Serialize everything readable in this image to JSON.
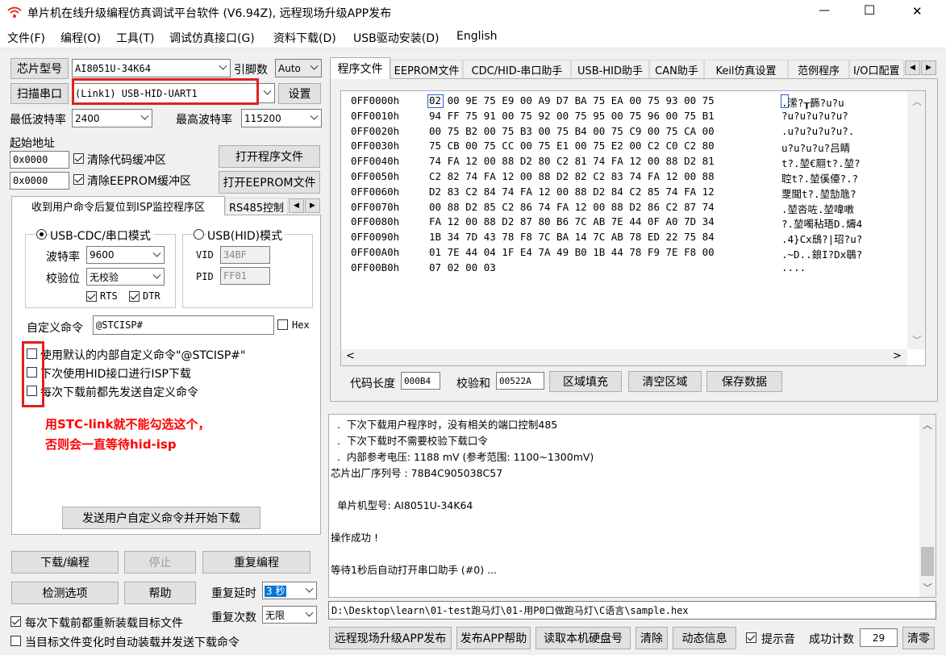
{
  "window": {
    "title": "单片机在线升级编程仿真调试平台软件 (V6.94Z), 远程现场升级APP发布",
    "controls": {
      "minimize": "—",
      "maximize": "☐",
      "close": "✕"
    }
  },
  "menu": [
    "文件(F)",
    "编程(O)",
    "工具(T)",
    "调试仿真接口(G)",
    "资料下载(D)",
    "USB驱动安装(D)",
    "English"
  ],
  "left": {
    "chip_label": "芯片型号",
    "chip_value": "AI8051U-34K64",
    "pins_label": "引脚数",
    "pins_value": "Auto",
    "scan_btn": "扫描串口",
    "port_value": "(Link1) USB-HID-UART1",
    "settings_btn": "设置",
    "min_baud_label": "最低波特率",
    "min_baud_value": "2400",
    "max_baud_label": "最高波特率",
    "max_baud_value": "115200",
    "start_addr_label": "起始地址",
    "addr1": "0x0000",
    "clear_code_label": "清除代码缓冲区",
    "open_prog_btn": "打开程序文件",
    "addr2": "0x0000",
    "clear_eeprom_label": "清除EEPROM缓冲区",
    "open_eeprom_btn": "打开EEPROM文件",
    "tabs": [
      "收到用户命令后复位到ISP监控程序区",
      "RS485控制"
    ],
    "radio_cdc": "USB-CDC/串口模式",
    "radio_hid": "USB(HID)模式",
    "baud_label": "波特率",
    "baud_value": "9600",
    "parity_label": "校验位",
    "parity_value": "无校验",
    "vid_label": "VID",
    "vid_value": "34BF",
    "pid_label": "PID",
    "pid_value": "FF01",
    "rts": "RTS",
    "dtr": "DTR",
    "custom_cmd_label": "自定义命令",
    "custom_cmd_value": "@STCISP#",
    "hex_label": "Hex",
    "opt1": "使用默认的内部自定义命令\"@STCISP#\"",
    "opt2": "下次使用HID接口进行ISP下载",
    "opt3": "每次下载前都先发送自定义命令",
    "annotation_line1": "用STC-link就不能勾选这个，",
    "annotation_line2": "否则会一直等待hid-isp",
    "send_cmd_btn": "发送用户自定义命令并开始下载",
    "download_btn": "下载/编程",
    "stop_btn": "停止",
    "reprogram_btn": "重复编程",
    "check_opts_btn": "检测选项",
    "help_btn": "帮助",
    "repeat_delay_label": "重复延时",
    "repeat_delay_value": "3 秒",
    "repeat_count_label": "重复次数",
    "repeat_count_value": "无限",
    "reload_label": "每次下载前都重新装载目标文件",
    "auto_label": "当目标文件变化时自动装载并发送下载命令"
  },
  "right": {
    "tabs": [
      "程序文件",
      "EEPROM文件",
      "CDC/HID-串口助手",
      "USB-HID助手",
      "CAN助手",
      "Keil仿真设置",
      "范例程序",
      "I/O口配置"
    ],
    "hex_rows": [
      {
        "addr": "0FF0000h",
        "bytes": "02 00 9E 75 E9 00 A9 D7 BA 75 EA 00 75 93 00 75",
        "ascii": ".潆?┰籂?u?u"
      },
      {
        "addr": "0FF0010h",
        "bytes": "94 FF 75 91 00 75 92 00 75 95 00 75 96 00 75 B1",
        "ascii": "?u?u?u?u?u?"
      },
      {
        "addr": "0FF0020h",
        "bytes": "00 75 B2 00 75 B3 00 75 B4 00 75 C9 00 75 CA 00",
        "ascii": ".u?u?u?u?u?."
      },
      {
        "addr": "0FF0030h",
        "bytes": "75 CB 00 75 CC 00 75 E1 00 75 E2 00 C2 C0 C2 80",
        "ascii": "u?u?u?u?吕睛"
      },
      {
        "addr": "0FF0040h",
        "bytes": "74 FA 12 00 88 D2 80 C2 81 74 FA 12 00 88 D2 81",
        "ascii": "t?.堃€翢t?.堃?"
      },
      {
        "addr": "0FF0050h",
        "bytes": "C2 82 74 FA 12 00 88 D2 82 C2 83 74 FA 12 00 88",
        "ascii": "聜t?.堃傒儓?.?"
      },
      {
        "addr": "0FF0060h",
        "bytes": "D2 83 C2 84 74 FA 12 00 88 D2 84 C2 85 74 FA 12",
        "ascii": "覂聞t?.堃勂卼?"
      },
      {
        "addr": "0FF0070h",
        "bytes": "00 88 D2 85 C2 86 74 FA 12 00 88 D2 86 C2 87 74",
        "ascii": ".堃呇咗.堃喡嘋"
      },
      {
        "addr": "0FF0080h",
        "bytes": "FA 12 00 88 D2 87 80 B6 7C AB 7E 44 0F A0 7D 34",
        "ascii": "?.堃噣秥珸D.燽4"
      },
      {
        "addr": "0FF0090h",
        "bytes": "1B 34 7D 43 78 F8 7C BA 14 7C AB 78 ED 22 75 84",
        "ascii": ".4}Cx鴟?|玿?u?"
      },
      {
        "addr": "0FF00A0h",
        "bytes": "01 7E 44 04 1F E4 7A 49 B0 1B 44 78 F9 7E F8 00",
        "ascii": ".~D..鋃I?Dx鶡?"
      },
      {
        "addr": "0FF00B0h",
        "bytes": "07 02 00 03",
        "ascii": "...."
      }
    ],
    "code_len_label": "代码长度",
    "code_len_value": "000B4",
    "checksum_label": "校验和",
    "checksum_value": "00522A",
    "fill_btn": "区域填充",
    "clear_btn": "清空区域",
    "save_btn": "保存数据",
    "log_lines": [
      "  .  下次下载用户程序时，没有相关的端口控制485",
      "  .  下次下载时不需要校验下载口令",
      "  .  内部参考电压: 1188 mV (参考范围: 1100~1300mV)",
      "芯片出厂序列号 : 78B4C905038C57",
      "",
      "  单片机型号: AI8051U-34K64",
      "",
      "操作成功 !",
      "",
      "等待1秒后自动打开串口助手 (#0) ..."
    ],
    "path": "D:\\Desktop\\learn\\01-test跑马灯\\01-用P0口做跑马灯\\C语言\\sample.hex",
    "bottom_btns": [
      "远程现场升级APP发布",
      "发布APP帮助",
      "读取本机硬盘号",
      "清除",
      "动态信息"
    ],
    "beep_label": "提示音",
    "success_label": "成功计数",
    "success_value": "29",
    "reset_btn": "清零"
  },
  "colors": {
    "highlight_red": "#e02020",
    "annotation_red": "#ff0000",
    "selection_blue": "#0078d7"
  }
}
